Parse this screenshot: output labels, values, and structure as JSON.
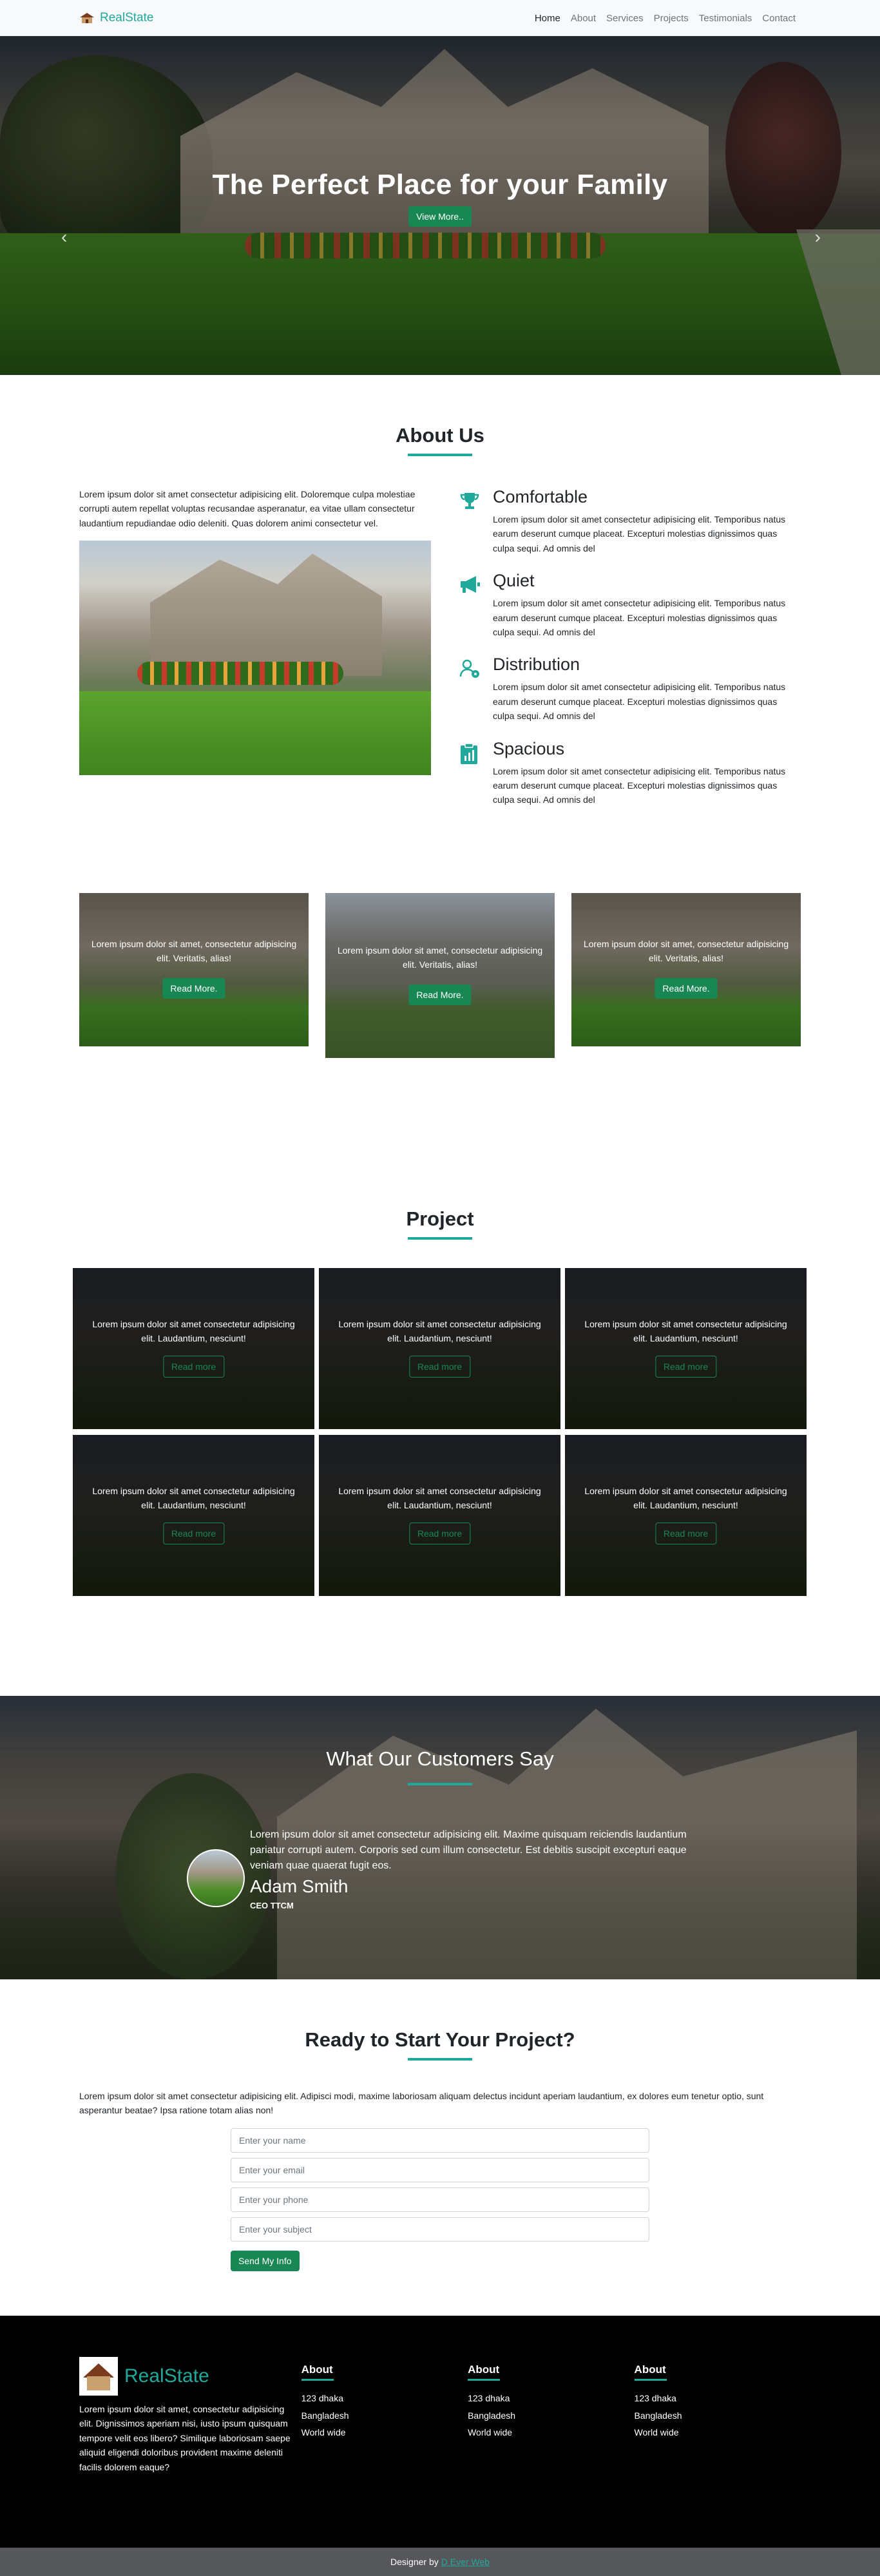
{
  "brand": {
    "name": "RealState",
    "accent": "#20a99a"
  },
  "nav": [
    "Home",
    "About",
    "Services",
    "Projects",
    "Testimonials",
    "Contact"
  ],
  "hero": {
    "title": "The Perfect Place for your Family",
    "button": "View More.."
  },
  "about": {
    "title": "About Us",
    "intro": "Lorem ipsum dolor sit amet consectetur adipisicing elit. Doloremque culpa molestiae corrupti autem repellat voluptas recusandae asperanatur, ea vitae ullam consectetur laudantium repudiandae odio deleniti. Quas dolorem animi consectetur vel.",
    "features": [
      {
        "title": "Comfortable",
        "icon": "trophy-icon",
        "text": "Lorem ipsum dolor sit amet consectetur adipisicing elit. Temporibus natus earum deserunt cumque placeat. Excepturi molestias dignissimos quas culpa sequi. Ad omnis del"
      },
      {
        "title": "Quiet",
        "icon": "megaphone-icon",
        "text": "Lorem ipsum dolor sit amet consectetur adipisicing elit. Temporibus natus earum deserunt cumque placeat. Excepturi molestias dignissimos quas culpa sequi. Ad omnis del"
      },
      {
        "title": "Distribution",
        "icon": "user-gear-icon",
        "text": "Lorem ipsum dolor sit amet consectetur adipisicing elit. Temporibus natus earum deserunt cumque placeat. Excepturi molestias dignissimos quas culpa sequi. Ad omnis del"
      },
      {
        "title": "Spacious",
        "icon": "clipboard-chart-icon",
        "text": "Lorem ipsum dolor sit amet consectetur adipisicing elit. Temporibus natus earum deserunt cumque placeat. Excepturi molestias dignissimos quas culpa sequi. Ad omnis del"
      }
    ]
  },
  "services": [
    {
      "text": "Lorem ipsum dolor sit amet, consectetur adipisicing elit. Veritatis, alias!",
      "button": "Read More."
    },
    {
      "text": "Lorem ipsum dolor sit amet, consectetur adipisicing elit. Veritatis, alias!",
      "button": "Read More."
    },
    {
      "text": "Lorem ipsum dolor sit amet, consectetur adipisicing elit. Veritatis, alias!",
      "button": "Read More."
    }
  ],
  "project": {
    "title": "Project",
    "cards": [
      {
        "text": "Lorem ipsum dolor sit amet consectetur adipisicing elit. Laudantium, nesciunt!",
        "button": "Read more"
      },
      {
        "text": "Lorem ipsum dolor sit amet consectetur adipisicing elit. Laudantium, nesciunt!",
        "button": "Read more"
      },
      {
        "text": "Lorem ipsum dolor sit amet consectetur adipisicing elit. Laudantium, nesciunt!",
        "button": "Read more"
      },
      {
        "text": "Lorem ipsum dolor sit amet consectetur adipisicing elit. Laudantium, nesciunt!",
        "button": "Read more"
      },
      {
        "text": "Lorem ipsum dolor sit amet consectetur adipisicing elit. Laudantium, nesciunt!",
        "button": "Read more"
      },
      {
        "text": "Lorem ipsum dolor sit amet consectetur adipisicing elit. Laudantium, nesciunt!",
        "button": "Read more"
      }
    ]
  },
  "testimonial": {
    "title": "What Our Customers Say",
    "quote": "Lorem ipsum dolor sit amet consectetur adipisicing elit. Maxime quisquam reiciendis laudantium pariatur corrupti autem. Corporis sed cum illum consectetur. Est debitis suscipit excepturi eaque veniam quae quaerat fugit eos.",
    "name": "Adam Smith",
    "role": "CEO TTCM"
  },
  "contact": {
    "title": "Ready to Start Your Project?",
    "lead": "Lorem ipsum dolor sit amet consectetur adipisicing elit. Adipisci modi, maxime laboriosam aliquam delectus incidunt aperiam laudantium, ex dolores eum tenetur optio, sunt asperantur beatae? Ipsa ratione totam alias non!",
    "placeholders": {
      "name": "Enter your name",
      "email": "Enter your email",
      "phone": "Enter your phone",
      "subject": "Enter your subject"
    },
    "submit": "Send My Info"
  },
  "footer": {
    "brand": "RealState",
    "text": "Lorem ipsum dolor sit amet, consectetur adipisicing elit. Dignissimos aperiam nisi, iusto ipsum quisquam tempore velit eos libero? Similique laboriosam saepe aliquid eligendi doloribus provident maxime deleniti facilis dolorem eaque?",
    "columns": [
      {
        "title": "About",
        "items": [
          "123 dhaka",
          "Bangladesh",
          "World wide"
        ]
      },
      {
        "title": "About",
        "items": [
          "123 dhaka",
          "Bangladesh",
          "World wide"
        ]
      },
      {
        "title": "About",
        "items": [
          "123 dhaka",
          "Bangladesh",
          "World wide"
        ]
      }
    ],
    "credit_prefix": "Designer by",
    "credit_link": "D Ever Web"
  }
}
